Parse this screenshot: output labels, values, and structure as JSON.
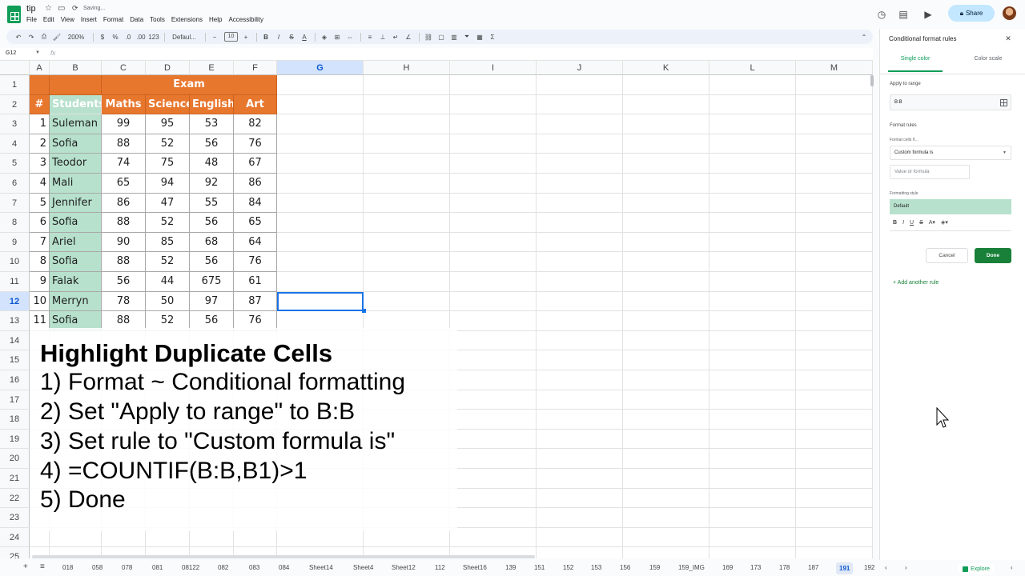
{
  "app": {
    "doc_title": "tip",
    "saving_text": "Saving...",
    "menus": [
      "File",
      "Edit",
      "View",
      "Insert",
      "Format",
      "Data",
      "Tools",
      "Extensions",
      "Help",
      "Accessibility"
    ],
    "share_label": "Share"
  },
  "toolbar": {
    "zoom": "200%",
    "currency": "$",
    "percent": "%",
    "format_num": "123",
    "font": "Defaul...",
    "font_size": "10"
  },
  "formula_bar": {
    "name_box": "G12",
    "fx": "fx"
  },
  "columns": [
    "A",
    "B",
    "C",
    "D",
    "E",
    "F",
    "G",
    "H",
    "I",
    "J",
    "K",
    "L",
    "M"
  ],
  "selected_column": "G",
  "rows": [
    "1",
    "2",
    "3",
    "4",
    "5",
    "6",
    "7",
    "8",
    "9",
    "10",
    "11",
    "12",
    "13",
    "14",
    "15",
    "16",
    "17",
    "18",
    "19",
    "20",
    "21",
    "22",
    "23",
    "24",
    "25"
  ],
  "selected_row": "12",
  "table": {
    "exam_header": "Exam",
    "header": [
      "#",
      "Students",
      "Maths",
      "Science",
      "English",
      "Art"
    ],
    "rows": [
      [
        "1",
        "Suleman",
        "99",
        "95",
        "53",
        "82"
      ],
      [
        "2",
        "Sofia",
        "88",
        "52",
        "56",
        "76"
      ],
      [
        "3",
        "Teodor",
        "74",
        "75",
        "48",
        "67"
      ],
      [
        "4",
        "Mali",
        "65",
        "94",
        "92",
        "86"
      ],
      [
        "5",
        "Jennifer",
        "86",
        "47",
        "55",
        "84"
      ],
      [
        "6",
        "Sofia",
        "88",
        "52",
        "56",
        "65"
      ],
      [
        "7",
        "Ariel",
        "90",
        "85",
        "68",
        "64"
      ],
      [
        "8",
        "Sofia",
        "88",
        "52",
        "56",
        "76"
      ],
      [
        "9",
        "Falak",
        "56",
        "44",
        "675",
        "61"
      ],
      [
        "10",
        "Merryn",
        "78",
        "50",
        "97",
        "87"
      ],
      [
        "11",
        "Sofia",
        "88",
        "52",
        "56",
        "76"
      ]
    ]
  },
  "overlay": {
    "title": "Highlight Duplicate Cells",
    "lines": [
      "1) Format ~ Conditional formatting",
      "2) Set \"Apply to range\" to B:B",
      "3) Set rule to \"Custom formula is\"",
      "4) =COUNTIF(B:B,B1)>1",
      "5) Done"
    ]
  },
  "sheet_tabs": [
    "018",
    "058",
    "078",
    "081",
    "08122",
    "082",
    "083",
    "084",
    "Sheet14",
    "Sheet4",
    "Sheet12",
    "112",
    "Sheet16",
    "139",
    "151",
    "152",
    "153",
    "156",
    "159",
    "159_IMG",
    "169",
    "173",
    "178",
    "187",
    "191",
    "192"
  ],
  "active_sheet": "191",
  "explore_label": "Explore",
  "panel": {
    "title": "Conditional format rules",
    "tab_single": "Single color",
    "tab_scale": "Color scale",
    "apply_label": "Apply to range",
    "range_value": "B:B",
    "format_rules_label": "Format rules",
    "format_cells_if": "Format cells if…",
    "condition": "Custom formula is",
    "value_placeholder": "Value or formula",
    "formatting_style_label": "Formatting style",
    "style_preview": "Default",
    "cancel_label": "Cancel",
    "done_label": "Done",
    "add_rule_label": "+ Add another rule"
  },
  "colors": {
    "header_orange": "#e8772e",
    "student_green": "#b7e1cd",
    "accent_green": "#188038",
    "selection_blue": "#1a73e8"
  }
}
